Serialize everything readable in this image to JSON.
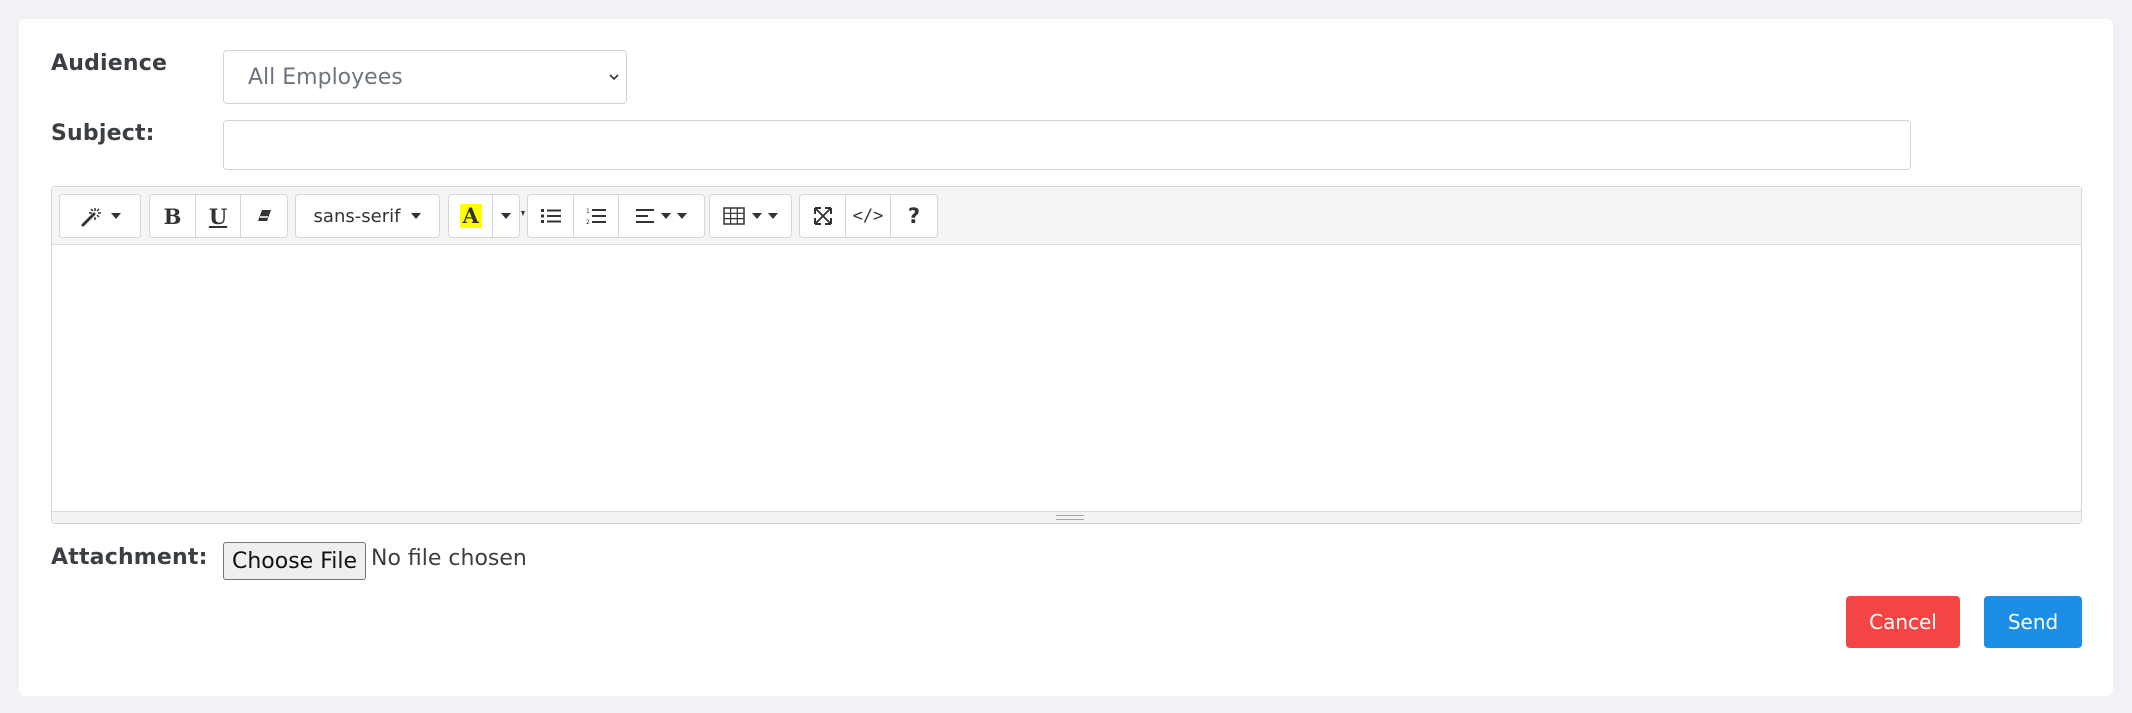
{
  "form": {
    "audience_label": "Audience",
    "audience_value": "All Employees",
    "subject_label": "Subject:",
    "subject_value": "",
    "attachment_label": "Attachment:",
    "choose_file_label": "Choose File",
    "file_status": "No file chosen"
  },
  "toolbar": {
    "groups": [
      [
        "magic-wand-style-dropdown"
      ],
      [
        "bold",
        "underline",
        "eraser-clear-format"
      ],
      [
        "font-family-dropdown"
      ],
      [
        "highlight-color",
        "color-dropdown"
      ],
      [
        "unordered-list",
        "ordered-list",
        "paragraph-align-dropdown"
      ],
      [
        "table-dropdown"
      ],
      [
        "fullscreen",
        "code-view",
        "help"
      ]
    ],
    "bold_label": "B",
    "underline_label": "U",
    "font_family": "sans-serif",
    "highlight_label": "A",
    "code_label": "</>",
    "help_label": "?",
    "highlight_color": "#ffff00"
  },
  "actions": {
    "cancel_label": "Cancel",
    "send_label": "Send",
    "cancel_color": "#f44545",
    "send_color": "#1c8ee6"
  }
}
